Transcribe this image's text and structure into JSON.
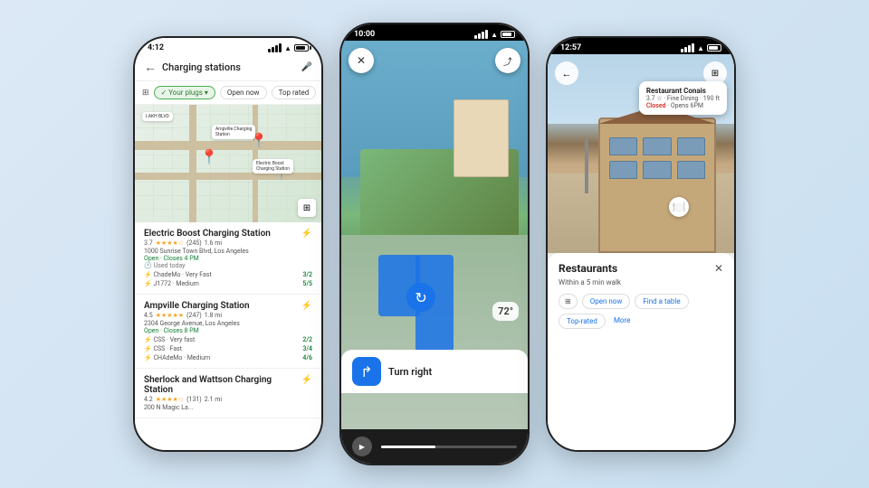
{
  "background": "#d0e4f5",
  "phone1": {
    "status_time": "4:12",
    "search_text": "Charging stations",
    "filters": {
      "filter_icon_label": "⊞",
      "your_plugs": "✓ Your plugs ▾",
      "open_now": "Open now",
      "top_rated": "Top rated"
    },
    "stations": [
      {
        "name": "Electric Boost Charging Station",
        "rating": "3.7",
        "reviews": "(245)",
        "distance": "1.6 mi",
        "address": "1000 Sunrise Town Blvd, Los Angeles",
        "hours": "Open · Closes 4 PM",
        "used": "Used today",
        "plugs": [
          {
            "name": "ChadeMo",
            "speed": "Very Fast",
            "avail": "3/2"
          },
          {
            "name": "J1772",
            "speed": "Medium",
            "avail": "5/5"
          }
        ]
      },
      {
        "name": "Ampville Charging Station",
        "rating": "4.5",
        "reviews": "(247)",
        "distance": "1.8 mi",
        "address": "2304 George Avenue, Los Angeles",
        "hours": "Open · Closes 8 PM",
        "used": "",
        "plugs": [
          {
            "name": "CSS",
            "speed": "Very fast",
            "avail": "2/2"
          },
          {
            "name": "CSS",
            "speed": "Fast",
            "avail": "3/4"
          },
          {
            "name": "CHAdeMo",
            "speed": "Medium",
            "avail": "4/6"
          }
        ]
      },
      {
        "name": "Sherlock and Wattson Charging Station",
        "rating": "4.2",
        "reviews": "(131)",
        "distance": "2.1 mi",
        "address": "200 N Magic La...",
        "hours": "",
        "used": "",
        "plugs": []
      }
    ]
  },
  "phone2": {
    "status_time": "10:00",
    "temp": "72°",
    "instruction": "Turn right",
    "close_icon": "✕",
    "share_icon": "⤴"
  },
  "phone3": {
    "status_time": "12:57",
    "restaurant_name": "Restaurant Conais",
    "restaurant_rating": "3.7 ☆ · Fine Dining · 190 ft",
    "restaurant_status_closed": "Closed",
    "restaurant_opens": "· Opens 6PM",
    "nearby_title": "Restaurants",
    "nearby_subtitle": "Within a 5 min walk",
    "filters": [
      "Open now",
      "Find a table",
      "Top-rated",
      "More"
    ],
    "back_icon": "←",
    "book_icon": "⊞"
  }
}
